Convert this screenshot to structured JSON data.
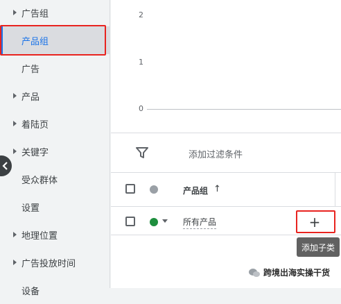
{
  "sidebar": {
    "items": [
      {
        "label": "广告组",
        "has_caret": true,
        "selected": false
      },
      {
        "label": "产品组",
        "has_caret": false,
        "selected": true
      },
      {
        "label": "广告",
        "has_caret": false,
        "selected": false
      },
      {
        "label": "产品",
        "has_caret": true,
        "selected": false
      },
      {
        "label": "着陆页",
        "has_caret": true,
        "selected": false
      },
      {
        "label": "关键字",
        "has_caret": true,
        "selected": false
      },
      {
        "label": "受众群体",
        "has_caret": false,
        "selected": false
      },
      {
        "label": "设置",
        "has_caret": false,
        "selected": false
      },
      {
        "label": "地理位置",
        "has_caret": true,
        "selected": false
      },
      {
        "label": "广告投放时间",
        "has_caret": true,
        "selected": false
      },
      {
        "label": "设备",
        "has_caret": false,
        "selected": false
      }
    ],
    "collapse_icon": "chevron-left-icon"
  },
  "chart": {
    "y_ticks": [
      "2",
      "1",
      "0"
    ]
  },
  "filter": {
    "icon": "filter-icon",
    "label": "添加过滤条件"
  },
  "table": {
    "columns": [
      {
        "label": "产品组",
        "sort": "ascending"
      }
    ],
    "rows": [
      {
        "label": "所有产品",
        "status_color": "#1e8e3e",
        "action_icon": "+"
      }
    ]
  },
  "tooltip": {
    "text": "添加子类"
  },
  "watermark": {
    "text": "跨境出海实操干货"
  },
  "colors": {
    "highlight_box": "#e8231f",
    "accent": "#1a73e8",
    "status_enabled": "#1e8e3e",
    "header_dot": "#9aa0a6"
  }
}
